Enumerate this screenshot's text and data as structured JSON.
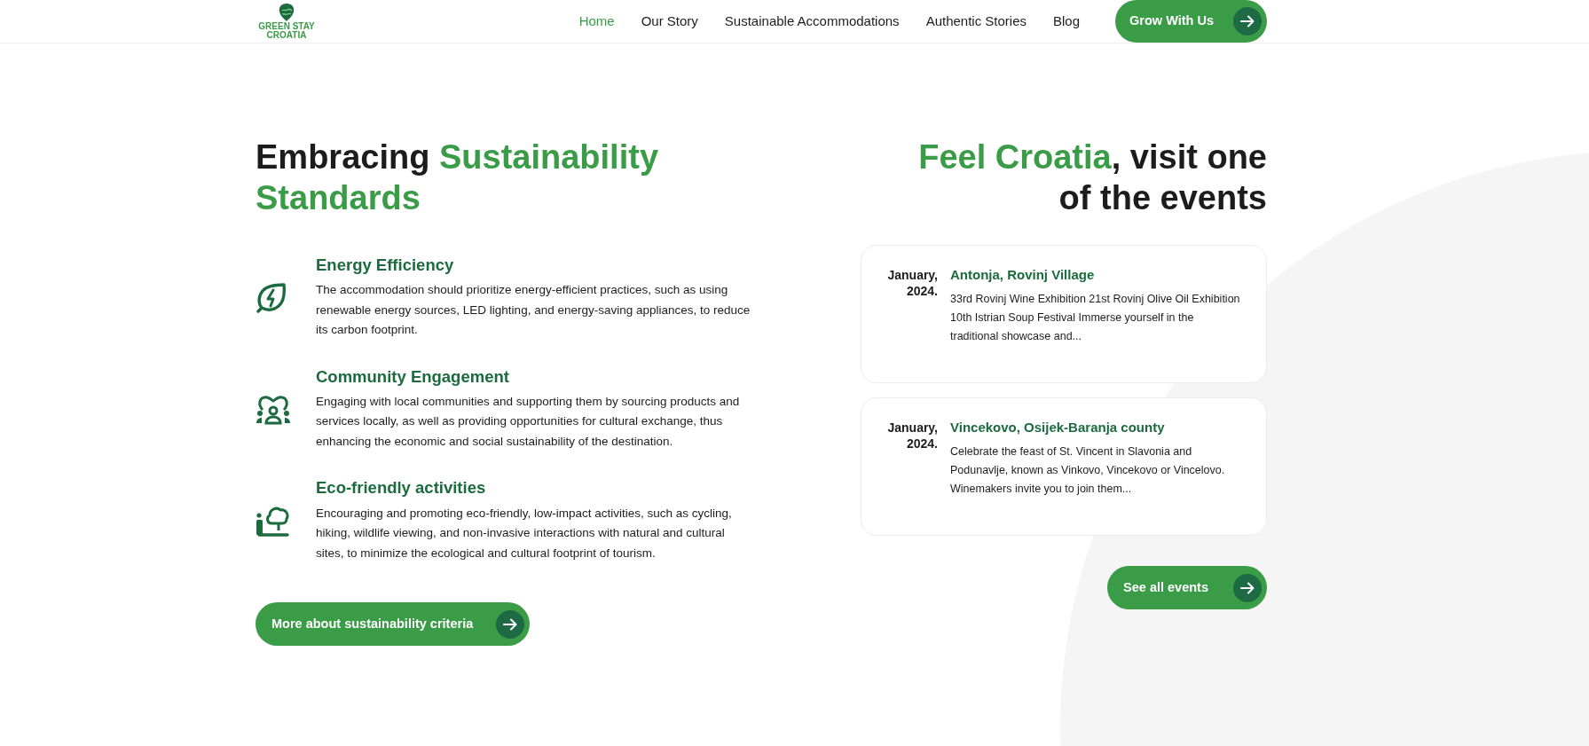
{
  "header": {
    "logo": {
      "line_1": "GREEN STAY",
      "line_2": "CROATIA"
    },
    "nav": [
      {
        "label": "Home",
        "selected": true
      },
      {
        "label": "Our Story",
        "selected": false
      },
      {
        "label": "Sustainable Accommodations",
        "selected": false
      },
      {
        "label": "Authentic Stories",
        "selected": false
      },
      {
        "label": "Blog",
        "selected": false
      }
    ],
    "cta": "Grow With Us"
  },
  "standards": {
    "heading": [
      {
        "text": "Embracing ",
        "accent": false
      },
      {
        "text": "Sustainability Standards",
        "accent": true
      }
    ],
    "items": [
      {
        "kind": "energy",
        "title": "Energy Efficiency",
        "text": "The accommodation should prioritize energy-efficient practices, such as using renewable energy sources, LED lighting, and energy-saving appliances, to reduce its carbon footprint."
      },
      {
        "kind": "community",
        "title": "Community Engagement",
        "text": "Engaging with local communities and supporting them by sourcing products and services locally, as well as providing opportunities for cultural exchange, thus enhancing the economic and social sustainability of the destination."
      },
      {
        "kind": "eco",
        "title": "Eco-friendly activities",
        "text": "Encouraging and promoting eco-friendly, low-impact activities, such as cycling, hiking, wildlife viewing, and non-invasive interactions with natural and cultural sites, to minimize the ecological and cultural footprint of tourism."
      }
    ],
    "button": "More about sustainability criteria"
  },
  "events": {
    "heading": [
      {
        "text": "Feel Croatia",
        "accent": true
      },
      {
        "text": ", visit one of the events",
        "accent": false
      }
    ],
    "items": [
      {
        "month": "January,",
        "year": "2024.",
        "title": "Antonja, Rovinj Village",
        "text": "33rd Rovinj Wine Exhibition 21st Rovinj Olive Oil Exhibition 10th Istrian Soup Festival Immerse yourself in the traditional showcase and..."
      },
      {
        "month": "January,",
        "year": "2024.",
        "title": "Vincekovo, Osijek-Baranja county",
        "text": "Celebrate the feast of St. Vincent in Slavonia and Podunavlje, known as Vinkovo, Vincekovo or Vincelovo. Winemakers invite you to join them..."
      }
    ],
    "button": "See all events"
  }
}
